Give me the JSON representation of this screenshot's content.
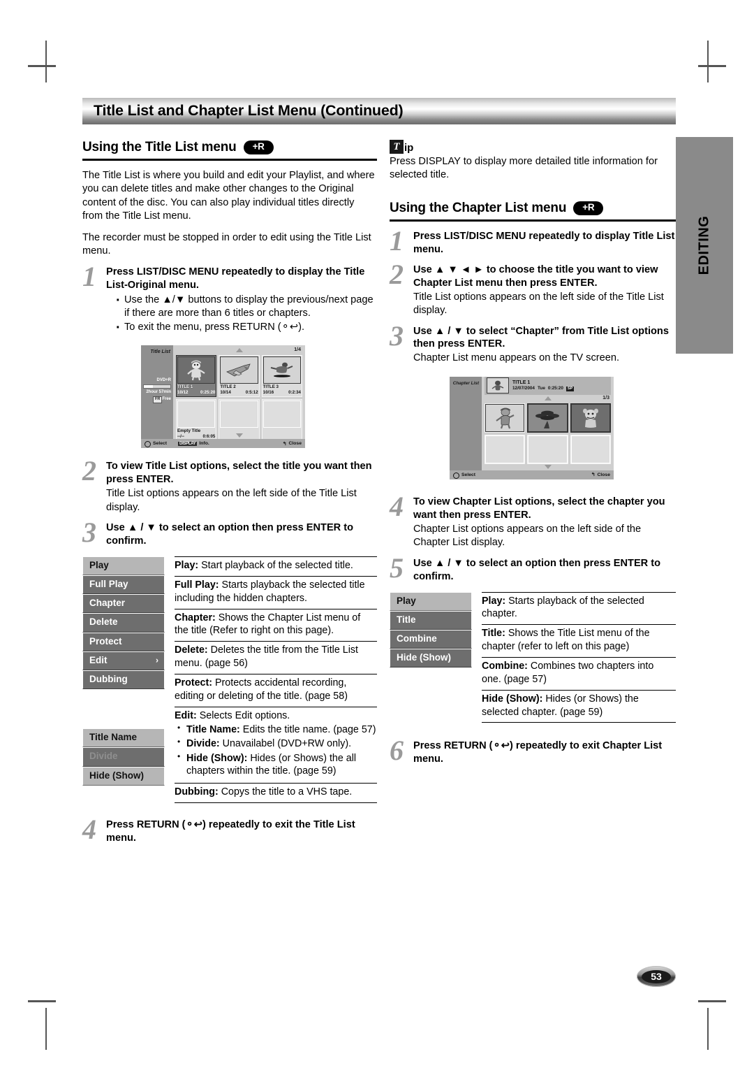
{
  "page": {
    "title": "Title List and Chapter List Menu (Continued)",
    "side_tab": "EDITING",
    "page_number": "53"
  },
  "left": {
    "section": {
      "heading": "Using the Title List menu",
      "badge": "+R"
    },
    "intro1": "The Title List is where you build and edit your Playlist, and where you can delete titles and make other changes to the Original content of the disc. You can also play individual titles directly from the Title List menu.",
    "intro2": "The recorder must be stopped in order to edit using the Title List menu.",
    "step1": {
      "num": "1",
      "head": "Press LIST/DISC MENU repeatedly to display the Title List-Original menu.",
      "bullets": [
        "Use the ▲/▼ buttons to display the previous/next page if there are more than 6 titles or chapters.",
        "To exit the menu, press RETURN (⚬↩)."
      ]
    },
    "step2": {
      "num": "2",
      "head": "To view Title List options, select the title you want then press ENTER.",
      "sub": "Title List options appears on the left side of the Title List display."
    },
    "step3": {
      "num": "3",
      "head": "Use ▲ / ▼ to select an option then press ENTER to confirm."
    },
    "step4": {
      "num": "4",
      "head": "Press RETURN (⚬↩) repeatedly to exit the Title List menu."
    },
    "options": [
      "Play",
      "Full Play",
      "Chapter",
      "Delete",
      "Protect",
      "Edit",
      "Dubbing"
    ],
    "edit_submenu": [
      "Title Name",
      "Divide",
      "Hide (Show)"
    ],
    "descriptions": [
      {
        "term": "Play:",
        "text": " Start playback of the selected title."
      },
      {
        "term": "Full Play:",
        "text": " Starts playback the selected title including the hidden chapters."
      },
      {
        "term": "Chapter:",
        "text": " Shows the Chapter List menu of the title (Refer to right on this page)."
      },
      {
        "term": "Delete:",
        "text": " Deletes the title from the Title List menu. (page 56)"
      },
      {
        "term": "Protect:",
        "text": " Protects accidental recording, editing or deleting of the title. (page 58)"
      }
    ],
    "edit_desc": {
      "term": "Edit:",
      "text": " Selects Edit options.",
      "items": [
        {
          "term": "Title Name:",
          "text": " Edits the title name. (page 57)"
        },
        {
          "term": "Divide:",
          "text": " Unavailabel (DVD+RW only)."
        },
        {
          "term": "Hide (Show):",
          "text": " Hides (or Shows) the all chapters within the title. (page 59)"
        }
      ]
    },
    "dubbing_desc": {
      "term": "Dubbing:",
      "text": " Copys the title to a VHS tape."
    }
  },
  "right": {
    "tip": {
      "icon_letter": "T",
      "word": "ip",
      "text": "Press DISPLAY to display more detailed title information for selected title."
    },
    "section": {
      "heading": "Using the Chapter List menu",
      "badge": "+R"
    },
    "step1": {
      "num": "1",
      "head": "Press LIST/DISC MENU repeatedly to display Title List menu."
    },
    "step2": {
      "num": "2",
      "head": "Use ▲ ▼ ◄ ► to choose the title you want to view Chapter List menu then press ENTER.",
      "sub": "Title List options appears on the left side of the Title List display."
    },
    "step3": {
      "num": "3",
      "head": "Use ▲ / ▼ to select “Chapter” from Title List options then press ENTER.",
      "sub": "Chapter List menu appears on the TV screen."
    },
    "step4": {
      "num": "4",
      "head": "To view Chapter List options, select the chapter you want then press ENTER.",
      "sub": "Chapter List options appears on the left side of the Chapter List display."
    },
    "step5": {
      "num": "5",
      "head": "Use ▲ / ▼ to select an option then press ENTER to confirm."
    },
    "step6": {
      "num": "6",
      "head": "Press RETURN (⚬↩) repeatedly to exit Chapter List menu."
    },
    "options": [
      "Play",
      "Title",
      "Combine",
      "Hide (Show)"
    ],
    "descriptions": [
      {
        "term": "Play:",
        "text": " Starts playback of the selected chapter."
      },
      {
        "term": "Title:",
        "text": " Shows the Title List menu of the chapter (refer to left on this page)"
      },
      {
        "term": "Combine:",
        "text": " Combines two chapters into one. (page 57)"
      },
      {
        "term": "Hide (Show):",
        "text": " Hides (or Shows) the selected chapter. (page 59)"
      }
    ]
  },
  "title_list_osd": {
    "label": "Title List",
    "disc_type": "DVD+R",
    "disc_free": "2hour 57min",
    "free_chip": "FR",
    "free_text": "Free",
    "page_indicator": "1/4",
    "titles": [
      {
        "name": "TITLE 1",
        "date": "10/12",
        "time": "0:25:20",
        "selected": true
      },
      {
        "name": "TITLE 2",
        "date": "10/14",
        "time": "0:5:12",
        "selected": false
      },
      {
        "name": "TITLE 3",
        "date": "10/16",
        "time": "0:2:34",
        "selected": false
      },
      {
        "name": "Empty Title",
        "date": "--/--",
        "time": "0:6:05",
        "selected": false
      }
    ],
    "footer": {
      "select": "Select",
      "chip": "DISPLAY",
      "info": "Info.",
      "close": "Close"
    }
  },
  "chapter_list_osd": {
    "label": "Chapter List",
    "title_name": "TITLE 1",
    "title_date": "12/07/2004",
    "title_day": "Tue",
    "title_time": "0:25:20",
    "rec_mode": "SP",
    "page_indicator": "1/3",
    "footer": {
      "select": "Select",
      "close": "Close"
    }
  }
}
